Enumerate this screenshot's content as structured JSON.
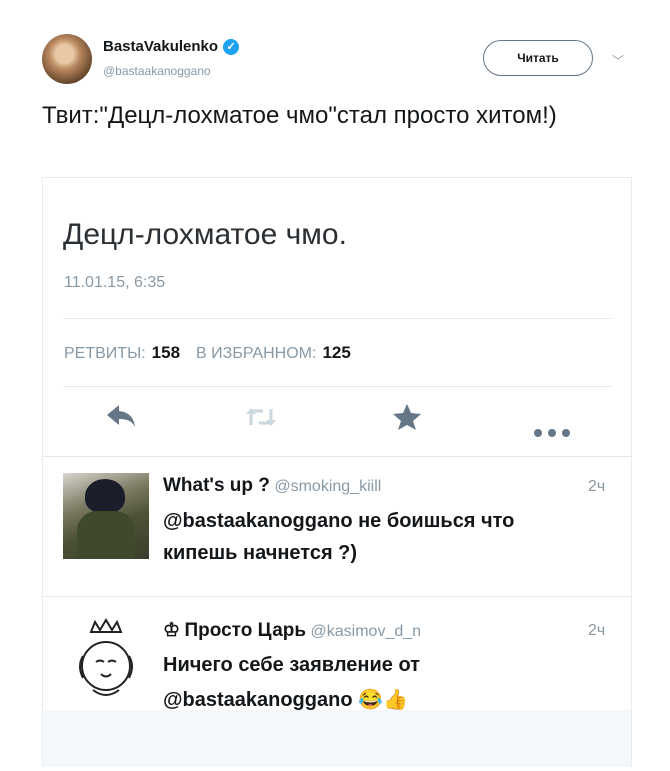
{
  "author": {
    "name": "BastaVakulenko",
    "handle": "@bastaakanoggano",
    "follow_label": "Читать"
  },
  "tweet_text": "Твит:\"Децл-лохматое чмо\"стал просто хитом!)",
  "embedded": {
    "text": "Децл-лохматое чмо.",
    "date": "11.01.15, 6:35",
    "retweets_label": "РЕТВИТЫ:",
    "retweets_count": "158",
    "favorites_label": "В ИЗБРАННОМ:",
    "favorites_count": "125",
    "replies": [
      {
        "name": "What's up ?",
        "handle": "@smoking_kiill",
        "time": "2ч",
        "text_line1": "@bastaakanoggano не боишься что",
        "text_line2": "кипешь начнется ?)"
      },
      {
        "name": "Просто Царь",
        "handle": "@kasimov_d_n",
        "time": "2ч",
        "text_line1": "Ничего себе заявление от",
        "text_line2": "@bastaakanoggano 😂👍"
      }
    ]
  },
  "colors": {
    "accent": "#1da1f2",
    "muted": "#8899a6"
  }
}
